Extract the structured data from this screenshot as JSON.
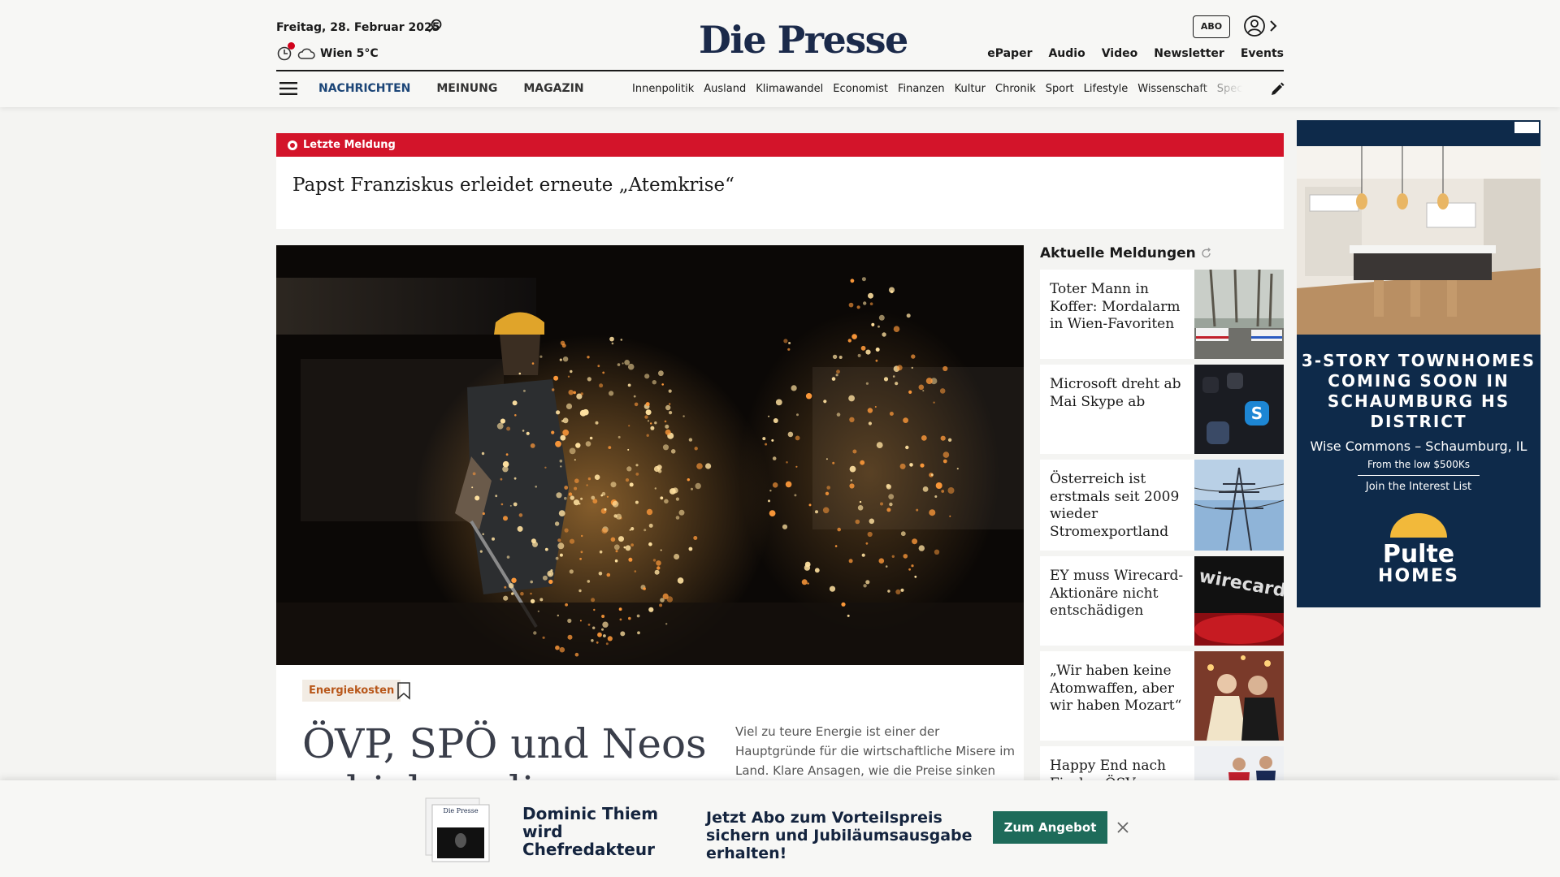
{
  "header": {
    "date": "Freitag, 28. Februar 2025",
    "weather": "Wien 5°C",
    "logo": "Die Presse",
    "abo_label": "ABO",
    "top_links": [
      "ePaper",
      "Audio",
      "Video",
      "Newsletter",
      "Events"
    ],
    "main_nav": [
      "NACHRICHTEN",
      "MEINUNG",
      "MAGAZIN"
    ],
    "sub_nav": [
      "Innenpolitik",
      "Ausland",
      "Klimawandel",
      "Economist",
      "Finanzen",
      "Kultur",
      "Chronik",
      "Sport",
      "Lifestyle",
      "Wissenschaft",
      "Spectrum"
    ]
  },
  "breaking": {
    "label": "Letzte Meldung",
    "headline": "Papst Franziskus erleidet erneute „Atemkrise“"
  },
  "hero": {
    "tag": "Energiekosten",
    "title": "ÖVP, SPÖ und Neos schicken die Wirtschaft",
    "teaser": "Viel zu teure Energie ist einer der Hauptgründe für die wirtschaftliche Misere im Land. Klare Ansagen, wie die Preise sinken"
  },
  "news": {
    "heading": "Aktuelle Meldungen",
    "items": [
      {
        "title": "Toter Mann in Koffer: Mordalarm in Wien-Favoriten"
      },
      {
        "title": "Microsoft dreht ab Mai Skype ab"
      },
      {
        "title": "Österreich ist erstmals seit 2009 wieder Stromexportland"
      },
      {
        "title": "EY muss Wirecard-Aktionäre nicht entschädigen"
      },
      {
        "title": "„Wir haben keine Atomwaffen, aber wir haben Mozart“"
      },
      {
        "title": "Happy End nach Fiasko: ÖSV"
      }
    ]
  },
  "ad": {
    "headline": "3-STORY TOWNHOMES COMING SOON IN SCHAUMBURG HS DISTRICT",
    "location": "Wise Commons – Schaumburg, IL",
    "price": "From the low $500Ks",
    "cta": "Join the Interest List",
    "brand_top": "Pulte",
    "brand_bottom": "HOMES"
  },
  "promo": {
    "name": "Dominic Thiem wird Chefredakteur",
    "offer": "Jetzt Abo zum Vorteilspreis sichern und Jubiläumsausgabe erhalten!",
    "button": "Zum Angebot",
    "paper_label": "Die Presse"
  },
  "colors": {
    "brand_navy": "#1b2a4a",
    "breaking_red": "#d3142a",
    "tag_orange": "#b8571a",
    "promo_button": "#1e6b5a",
    "ad_background": "#0e2a4a"
  }
}
